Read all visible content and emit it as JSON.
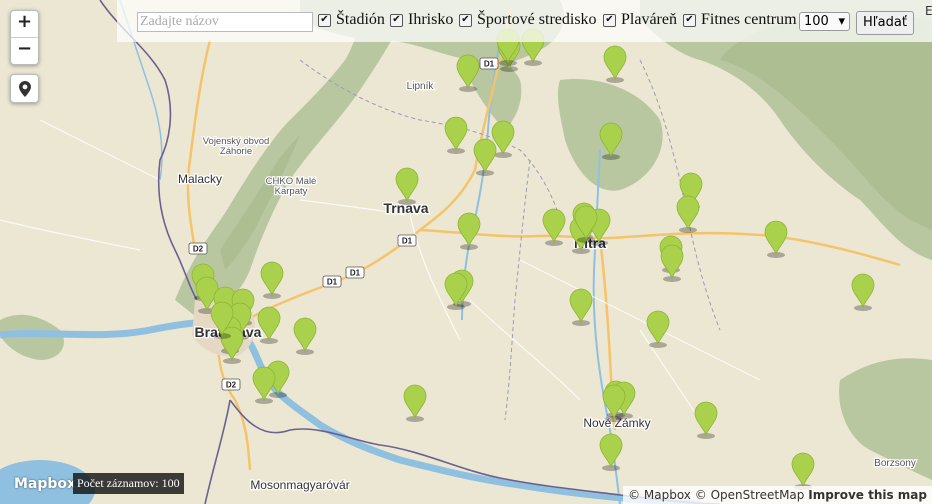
{
  "search": {
    "placeholder": "Zadajte názov"
  },
  "filters": [
    {
      "label": "Štadión",
      "checked": true
    },
    {
      "label": "Ihrisko",
      "checked": true
    },
    {
      "label": "Športové stredisko",
      "checked": true
    },
    {
      "label": "Plaváreň",
      "checked": true
    },
    {
      "label": "Fitnes centrum",
      "checked": true
    }
  ],
  "limit_select": {
    "value": "100"
  },
  "search_button": {
    "label": "Hľadať"
  },
  "zoom": {
    "in": "+",
    "out": "−"
  },
  "map_labels": [
    {
      "text": "Trnava",
      "kind": "city"
    },
    {
      "text": "Malacky",
      "kind": "town"
    },
    {
      "text": "Lipník",
      "kind": "small"
    },
    {
      "text": "Vojenský obvod",
      "kind": "area"
    },
    {
      "text": "Záhorie",
      "kind": "area"
    },
    {
      "text": "CHKO Malé",
      "kind": "area"
    },
    {
      "text": "Karpaty",
      "kind": "area"
    },
    {
      "text": "Bratislava",
      "kind": "city"
    },
    {
      "text": "Nitra",
      "kind": "city"
    },
    {
      "text": "Nové Zámky",
      "kind": "town"
    },
    {
      "text": "Mosonmagyaróvár",
      "kind": "town"
    },
    {
      "text": "Borzsony",
      "kind": "area"
    }
  ],
  "road_shields": [
    "D1",
    "D1",
    "D1",
    "D1",
    "D2",
    "D2"
  ],
  "markers_count": 46,
  "count_label": "Počet záznamov: 100",
  "logo": "Mapbox",
  "attribution": {
    "mapbox": "© Mapbox",
    "osm": "© OpenStreetMap",
    "improve": "Improve this map"
  },
  "corner_letter": "E",
  "colors": {
    "marker": "#a9d14b",
    "land": "#ece7d3",
    "forest": "#b9c7a1",
    "water": "#8fc0df",
    "border": "#6b6190"
  }
}
